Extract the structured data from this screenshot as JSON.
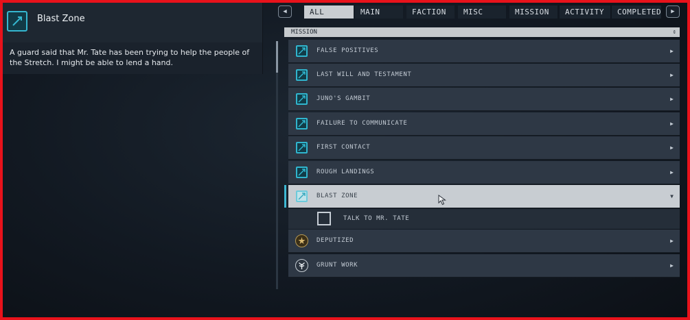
{
  "detail": {
    "title": "Blast Zone",
    "description": "A guard said that Mr. Tate has been trying to help the people of the Stretch. I might be able to lend a hand."
  },
  "tabs": {
    "prev_icon": "arrow-left-icon",
    "next_icon": "arrow-right-icon",
    "items": [
      "ALL",
      "MAIN",
      "FACTION",
      "MISC",
      "MISSION",
      "ACTIVITY",
      "COMPLETED"
    ],
    "active": "ALL"
  },
  "list": {
    "section": "MISSION",
    "sort_icon": "sort-updown-icon",
    "quests": [
      {
        "name": "FALSE POSITIVES",
        "icon": "mission-icon"
      },
      {
        "name": "LAST WILL AND TESTAMENT",
        "icon": "mission-icon"
      },
      {
        "name": "JUNO'S GAMBIT",
        "icon": "mission-icon"
      },
      {
        "name": "FAILURE TO COMMUNICATE",
        "icon": "mission-icon"
      },
      {
        "name": "FIRST CONTACT",
        "icon": "mission-icon"
      },
      {
        "name": "ROUGH LANDINGS",
        "icon": "mission-icon"
      },
      {
        "name": "BLAST ZONE",
        "icon": "mission-icon",
        "selected": true
      },
      {
        "name": "DEPUTIZED",
        "icon": "faction-badge-icon"
      },
      {
        "name": "GRUNT WORK",
        "icon": "faction-tree-icon"
      }
    ],
    "objective": "TALK TO MR. TATE"
  },
  "colors": {
    "accent": "#30b6cf",
    "frame": "#e8121b",
    "selected_row": "#c8cdd2",
    "row": "#2e3845"
  }
}
